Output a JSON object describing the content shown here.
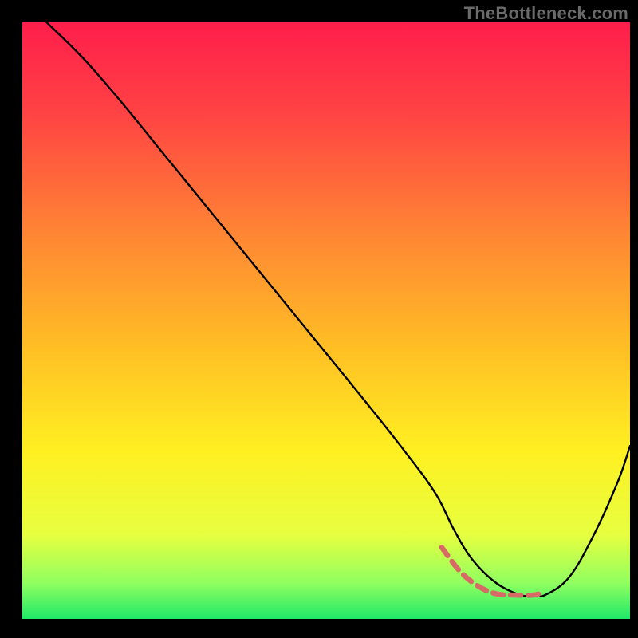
{
  "watermark": "TheBottleneck.com",
  "chart_data": {
    "type": "line",
    "title": "",
    "xlabel": "",
    "ylabel": "",
    "xlim": [
      0,
      100
    ],
    "ylim": [
      0,
      100
    ],
    "grid": false,
    "legend": false,
    "background_gradient": {
      "orientation": "vertical",
      "stops": [
        {
          "offset": 0.0,
          "color": "#ff1e4b"
        },
        {
          "offset": 0.15,
          "color": "#ff4244"
        },
        {
          "offset": 0.35,
          "color": "#ff8434"
        },
        {
          "offset": 0.55,
          "color": "#ffc024"
        },
        {
          "offset": 0.72,
          "color": "#fff022"
        },
        {
          "offset": 0.86,
          "color": "#e6ff40"
        },
        {
          "offset": 0.94,
          "color": "#90ff60"
        },
        {
          "offset": 1.0,
          "color": "#20e868"
        }
      ]
    },
    "series": [
      {
        "name": "bottleneck-curve",
        "stroke": "#000000",
        "stroke_width": 2.4,
        "x": [
          4,
          10,
          16,
          24,
          32,
          40,
          48,
          56,
          63,
          68,
          71,
          74,
          78,
          82,
          84,
          86,
          90,
          94,
          98,
          100
        ],
        "y": [
          100,
          94,
          87,
          77,
          67,
          57,
          47,
          37,
          28,
          21,
          15,
          10,
          6,
          4,
          4,
          4,
          7,
          14,
          23,
          29
        ]
      },
      {
        "name": "optimal-range",
        "stroke": "#d86a66",
        "stroke_width": 6.5,
        "dash": [
          13,
          9
        ],
        "linecap": "round",
        "x": [
          69,
          72,
          75,
          78,
          81,
          84,
          86
        ],
        "y": [
          12,
          8,
          5.5,
          4.2,
          4,
          4,
          4.5
        ]
      }
    ]
  }
}
